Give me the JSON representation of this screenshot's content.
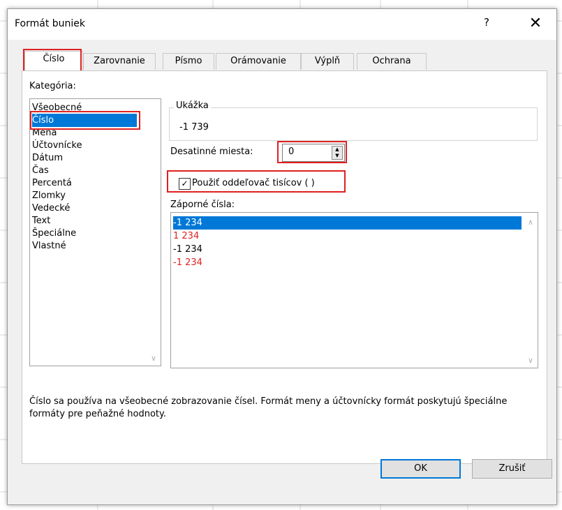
{
  "dialog": {
    "title": "Formát buniek",
    "help_label": "?",
    "close_label": "✕"
  },
  "tabs": [
    {
      "label": "Číslo",
      "active": true
    },
    {
      "label": "Zarovnanie",
      "active": false
    },
    {
      "label": "Písmo",
      "active": false
    },
    {
      "label": "Orámovanie",
      "active": false
    },
    {
      "label": "Výplň",
      "active": false
    },
    {
      "label": "Ochrana",
      "active": false
    }
  ],
  "category": {
    "label": "Kategória:",
    "items": [
      "Všeobecné",
      "Číslo",
      "Mena",
      "Účtovnícke",
      "Dátum",
      "Čas",
      "Percentá",
      "Zlomky",
      "Vedecké",
      "Text",
      "Špeciálne",
      "Vlastné"
    ],
    "selected": "Číslo"
  },
  "sample": {
    "label": "Ukážka",
    "value": "-1 739"
  },
  "decimal": {
    "label": "Desatinné miesta:",
    "value": "0"
  },
  "thousands": {
    "label": "Použiť oddeľovač tisícov ( )",
    "checked": true
  },
  "negative": {
    "label": "Záporné čísla:",
    "items": [
      {
        "text": "-1 234",
        "color": "#000000",
        "selected": true
      },
      {
        "text": "1 234",
        "color": "#e02020",
        "selected": false
      },
      {
        "text": "-1 234",
        "color": "#000000",
        "selected": false
      },
      {
        "text": "-1 234",
        "color": "#e02020",
        "selected": false
      }
    ]
  },
  "description": "Číslo sa používa na všeobecné zobrazovanie čísel. Formát meny a účtovnícky formát poskytujú špeciálne formáty pre peňažné hodnoty.",
  "buttons": {
    "ok": "OK",
    "cancel": "Zrušiť"
  },
  "colors": {
    "selection": "#0078d7",
    "highlight_box": "#e02020",
    "dialog_bg": "#f0f0f0"
  }
}
